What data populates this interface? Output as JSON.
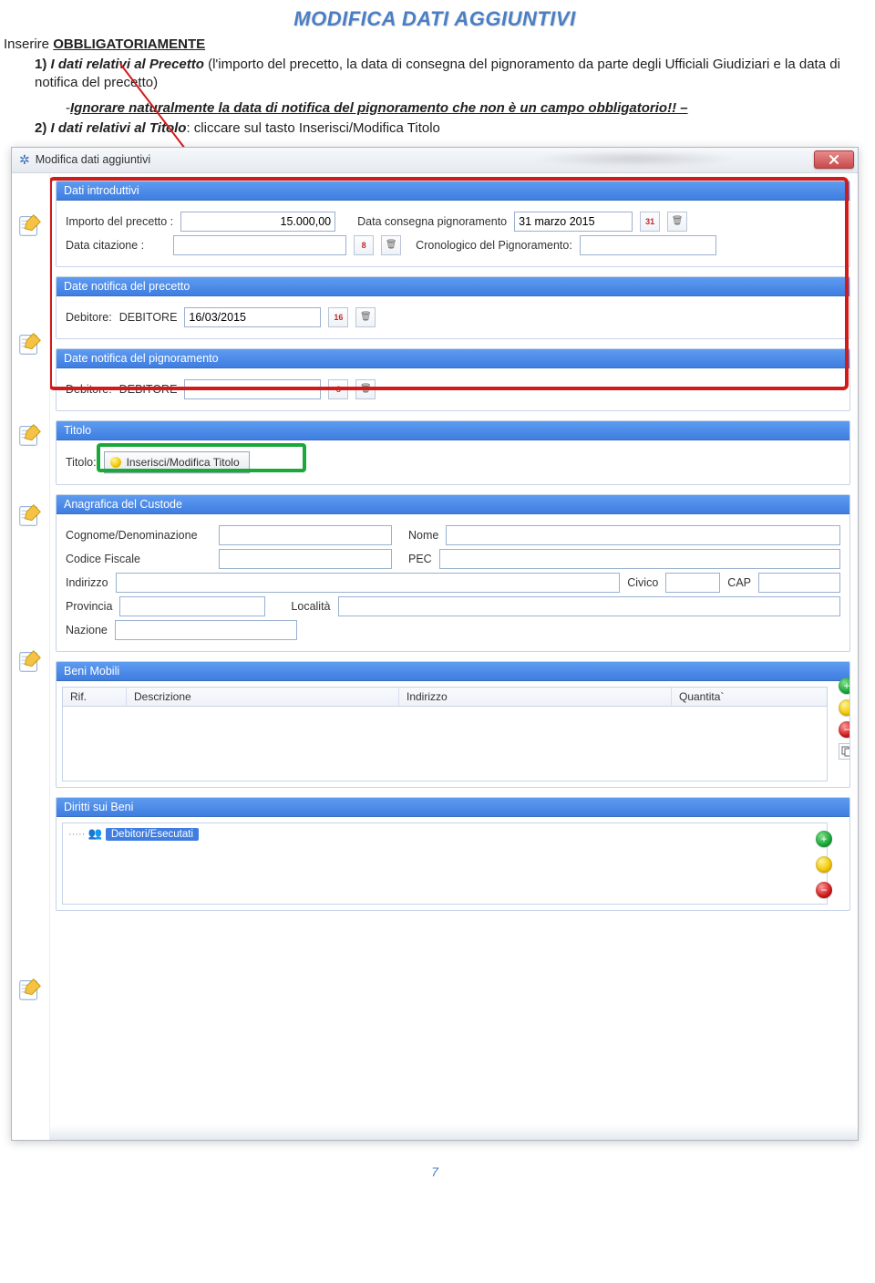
{
  "heading": "MODIFICA DATI AGGIUNTIVI",
  "intro_prefix": "Inserire ",
  "intro_mandatory": "OBBLIGATORIAMENTE",
  "item1_num": "1)",
  "item1_bi": "I dati relativi al Precetto",
  "item1_body": " (l'importo del precetto, la data di consegna del pignoramento da parte degli Ufficiali Giudiziari e  la data di notifica del precetto)",
  "subnote_prefix": "-",
  "subnote_bi": "Ignorare naturalmente la data di notifica del pignoramento che non è un campo obbligatorio!! –",
  "item2_num": "2)",
  "item2_bi": "I dati relativi al Titolo",
  "item2_body": ": cliccare sul tasto Inserisci/Modifica Titolo",
  "window": {
    "title": "Modifica dati aggiuntivi",
    "sections": {
      "dati_introduttivi": {
        "header": "Dati introduttivi",
        "importo_label": "Importo del precetto :",
        "importo_value": "15.000,00",
        "data_consegna_label": "Data consegna pignoramento",
        "data_consegna_value": "31 marzo 2015",
        "data_consegna_cal": "31",
        "data_citazione_label": "Data citazione :",
        "data_citazione_value": "",
        "data_citazione_cal": "8",
        "cronologico_label": "Cronologico del Pignoramento:",
        "cronologico_value": ""
      },
      "notifica_precetto": {
        "header": "Date notifica del precetto",
        "debitore_label": "Debitore:",
        "debitore_name": "DEBITORE",
        "debitore_date": "16/03/2015",
        "debitore_cal": "16"
      },
      "notifica_pignoramento": {
        "header": "Date notifica del pignoramento",
        "debitore_label": "Debitore:",
        "debitore_name": "DEBITORE",
        "debitore_date": "",
        "debitore_cal": "8"
      },
      "titolo": {
        "header": "Titolo",
        "label": "Titolo:",
        "button": "Inserisci/Modifica Titolo"
      },
      "custode": {
        "header": "Anagrafica del Custode",
        "cognome_label": "Cognome/Denominazione",
        "nome_label": "Nome",
        "cf_label": "Codice Fiscale",
        "pec_label": "PEC",
        "indirizzo_label": "Indirizzo",
        "civico_label": "Civico",
        "cap_label": "CAP",
        "provincia_label": "Provincia",
        "localita_label": "Località",
        "nazione_label": "Nazione"
      },
      "beni_mobili": {
        "header": "Beni Mobili",
        "col_rif": "Rif.",
        "col_descrizione": "Descrizione",
        "col_indirizzo": "Indirizzo",
        "col_quantita": "Quantita`"
      },
      "diritti": {
        "header": "Diritti sui Beni",
        "node": "Debitori/Esecutati"
      }
    }
  },
  "page_number": "7"
}
